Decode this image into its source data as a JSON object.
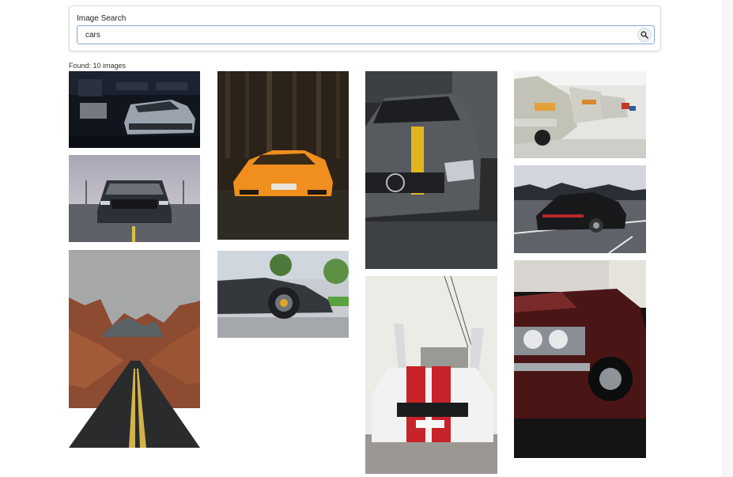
{
  "search": {
    "label": "Image Search",
    "query": "cars",
    "button_icon": "search-icon"
  },
  "results": {
    "found_text": "Found: 10 images",
    "images": [
      {
        "id": "img-1",
        "subject": "gray camaro in dark garage",
        "tone": "#1c2430"
      },
      {
        "id": "img-2",
        "subject": "gray mustang front view",
        "tone": "#8b8f97"
      },
      {
        "id": "img-3",
        "subject": "desert road between red rocks",
        "tone": "#9a5a3c"
      },
      {
        "id": "img-4",
        "subject": "orange lamborghini in forest",
        "tone": "#e78a1d"
      },
      {
        "id": "img-5",
        "subject": "black supercar side view",
        "tone": "#3a3d42"
      },
      {
        "id": "img-6",
        "subject": "gray mercedes with yellow stripe",
        "tone": "#585c62"
      },
      {
        "id": "img-7",
        "subject": "white mustang with red stripes",
        "tone": "#c62828"
      },
      {
        "id": "img-8",
        "subject": "row of vintage bmw cars",
        "tone": "#d9d6cc"
      },
      {
        "id": "img-9",
        "subject": "black porsche rear view",
        "tone": "#1d1f22"
      },
      {
        "id": "img-10",
        "subject": "red classic car chrome grille",
        "tone": "#5a1616"
      }
    ]
  }
}
